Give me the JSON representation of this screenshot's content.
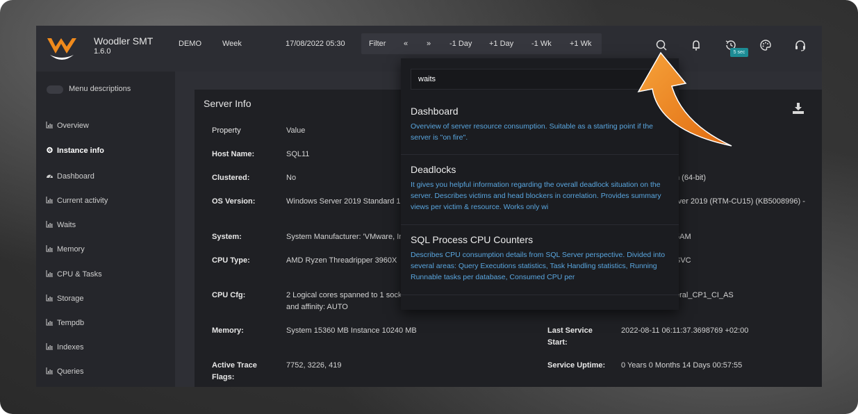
{
  "app": {
    "name": "Woodler SMT",
    "version": "1.6.0"
  },
  "header": {
    "instance": "DEMO",
    "range": "Week",
    "datetime": "17/08/2022 05:30",
    "filter": {
      "label": "Filter",
      "prev": "«",
      "next": "»",
      "minus_day": "-1 Day",
      "plus_day": "+1 Day",
      "minus_week": "-1 Wk",
      "plus_week": "+1 Wk"
    },
    "refresh_badge": "5 sec",
    "icons": [
      "search-icon",
      "bell-icon",
      "history-icon",
      "palette-icon",
      "headset-icon"
    ]
  },
  "sidebar": {
    "toggle_label": "Menu descriptions",
    "items": [
      {
        "label": "Overview",
        "icon": "chart-icon"
      },
      {
        "label": "Instance info",
        "icon": "gear-icon"
      },
      {
        "label": "Dashboard",
        "icon": "dashboard-icon"
      },
      {
        "label": "Current activity",
        "icon": "chart-icon"
      },
      {
        "label": "Waits",
        "icon": "chart-icon"
      },
      {
        "label": "Memory",
        "icon": "chart-icon"
      },
      {
        "label": "CPU & Tasks",
        "icon": "chart-icon"
      },
      {
        "label": "Storage",
        "icon": "chart-icon"
      },
      {
        "label": "Tempdb",
        "icon": "chart-icon"
      },
      {
        "label": "Indexes",
        "icon": "chart-icon"
      },
      {
        "label": "Queries",
        "icon": "chart-icon"
      }
    ]
  },
  "server_info": {
    "title": "Server Info",
    "header": {
      "property": "Property",
      "value": "Value"
    },
    "rows": [
      {
        "label": "Host Name:",
        "value": "SQL11"
      },
      {
        "label": "Clustered:",
        "value": "No"
      },
      {
        "label": "OS Version:",
        "value": "Windows Server 2019 Standard 1"
      },
      {
        "label": "System:",
        "value": "System Manufacturer: 'VMware, In"
      },
      {
        "label": "CPU Type:",
        "value": "AMD Ryzen Threadripper 3960X"
      },
      {
        "label": "CPU Cfg:",
        "value": "2 Logical cores spanned to 1 sock",
        "value2": "and affinity: AUTO"
      },
      {
        "label": "Memory:",
        "value": "System 15360 MB Instance 10240 MB"
      },
      {
        "label": "Active Trace",
        "label2": "Flags:",
        "value": "7752, 3226, 419"
      }
    ],
    "right_fragments": {
      "bitness": "n (64-bit)",
      "version": "rver 2019 (RTM-CU15) (KB5008996) -",
      "time": "5AM",
      "service": "SVC",
      "collation": "eral_CP1_CI_AS"
    },
    "right_rows": [
      {
        "label": "Last Service",
        "label2": "Start:",
        "value": "2022-08-11 06:11:37.3698769 +02:00"
      },
      {
        "label": "Service Uptime:",
        "value": "0 Years 0 Months 14 Days 00:57:55"
      }
    ]
  },
  "search": {
    "query": "waits",
    "results": [
      {
        "title": "Dashboard",
        "description": "Overview of server resource consumption. Suitable as a starting point if the server is \"on fire\"."
      },
      {
        "title": "Deadlocks",
        "description": "It gives you helpful information regarding the overall deadlock situation on the server. Describes victims and head blockers in correlation. Provides summary views per victim & resource. Works only wi"
      },
      {
        "title": "SQL Process CPU Counters",
        "description": "Describes CPU consumption details from SQL Server perspective. Divided into several areas: Query Executions statistics, Task Handling statistics, Running Runnable tasks per database, Consumed CPU per"
      }
    ]
  },
  "colors": {
    "accent": "#f08a1c",
    "link": "#5aa7e0",
    "badge": "#1d8c95"
  }
}
